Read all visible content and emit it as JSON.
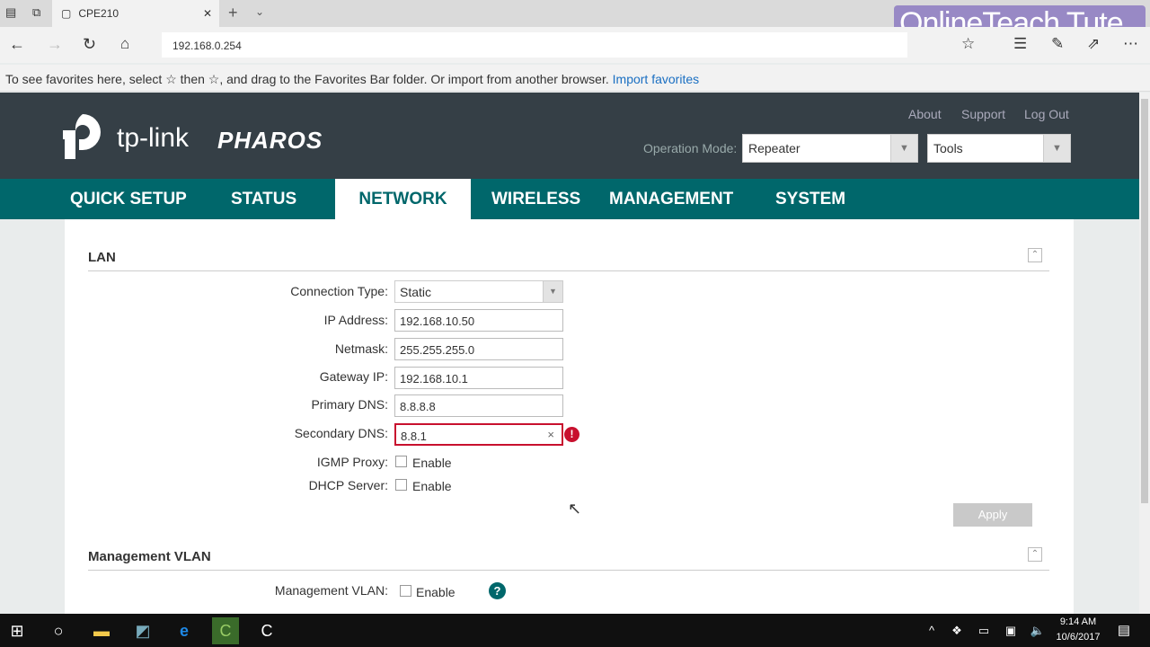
{
  "browser": {
    "tab_title": "CPE210",
    "url": "192.168.0.254",
    "favorites_text": "To see favorites here, select ☆ then ☆, and drag to the Favorites Bar folder. Or import from another browser.",
    "import_link": "Import favorites",
    "watermark": "OnlineTeach Tute"
  },
  "header": {
    "brand": "tp-link",
    "product": "PHAROS",
    "links": [
      "About",
      "Support",
      "Log Out"
    ],
    "operation_mode_label": "Operation Mode:",
    "operation_mode": "Repeater",
    "tools": "Tools"
  },
  "nav": [
    "QUICK SETUP",
    "STATUS",
    "NETWORK",
    "WIRELESS",
    "MANAGEMENT",
    "SYSTEM"
  ],
  "nav_active": "NETWORK",
  "lan": {
    "title": "LAN",
    "fields": [
      {
        "label": "Connection Type:",
        "value": "Static"
      },
      {
        "label": "IP Address:",
        "value": "192.168.10.50"
      },
      {
        "label": "Netmask:",
        "value": "255.255.255.0"
      },
      {
        "label": "Gateway IP:",
        "value": "192.168.10.1"
      },
      {
        "label": "Primary DNS:",
        "value": "8.8.8.8"
      },
      {
        "label": "Secondary DNS:",
        "value": "8.8.1"
      }
    ],
    "igmp_label": "IGMP Proxy:",
    "dhcp_label": "DHCP Server:",
    "enable": "Enable",
    "apply": "Apply"
  },
  "vlan": {
    "title": "Management VLAN",
    "label": "Management VLAN:",
    "enable": "Enable"
  },
  "taskbar": {
    "time": "9:14 AM",
    "date": "10/6/2017"
  },
  "colors": {
    "header": "#353f46",
    "nav": "#00676b",
    "error": "#c8102e"
  }
}
